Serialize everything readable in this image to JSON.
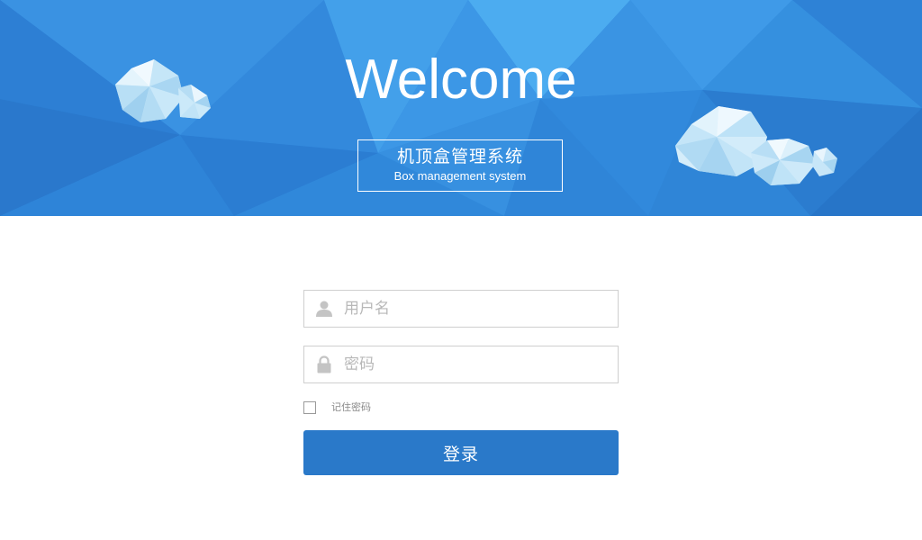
{
  "header": {
    "title": "Welcome",
    "subtitle_cn": "机顶盒管理系统",
    "subtitle_en": "Box management system"
  },
  "form": {
    "username_placeholder": "用户名",
    "username_value": "",
    "password_placeholder": "密码",
    "password_value": "",
    "remember_label": "记住密码",
    "remember_checked": false,
    "submit_label": "登录"
  },
  "icons": {
    "username": "user-icon",
    "password": "lock-icon"
  },
  "colors": {
    "banner": "#2f86db",
    "button": "#2a79c9",
    "icon_gray": "#c4c4c4"
  }
}
